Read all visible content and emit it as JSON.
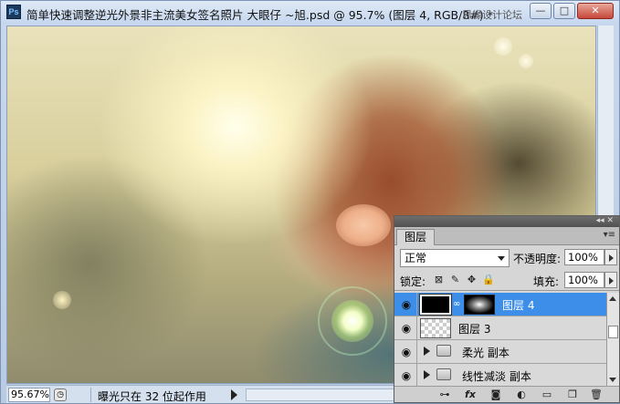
{
  "window": {
    "title": "简单快速调整逆光外景非主流美女签名照片 大眼仔 ~旭.psd @ 95.7% (图层 4, RGB/8#) *",
    "watermark": "思缘设计论坛",
    "app_icon": "Ps",
    "controls": {
      "minimize": "—",
      "maximize": "□",
      "close": "✕"
    }
  },
  "statusbar": {
    "zoom": "95.67%",
    "info": "曝光只在 32 位起作用"
  },
  "layers_panel": {
    "tab": "图层",
    "blend_mode": "正常",
    "opacity_label": "不透明度:",
    "opacity": "100%",
    "lock_label": "锁定:",
    "fill_label": "填充:",
    "fill": "100%",
    "layers": [
      {
        "name": "图层 4",
        "selected": true,
        "type": "layer-with-mask"
      },
      {
        "name": "图层 3",
        "selected": false,
        "type": "layer"
      },
      {
        "name": "柔光 副本",
        "selected": false,
        "type": "group"
      },
      {
        "name": "线性减淡 副本",
        "selected": false,
        "type": "group"
      }
    ],
    "icons": [
      "link-icon",
      "fx-icon",
      "mask-icon",
      "adjustment-icon",
      "new-group-icon",
      "new-layer-icon",
      "trash-icon"
    ]
  },
  "colors": {
    "selection": "#3c8ee8",
    "panel": "#d6d6d6",
    "titlebar": "#c5d6ee"
  }
}
